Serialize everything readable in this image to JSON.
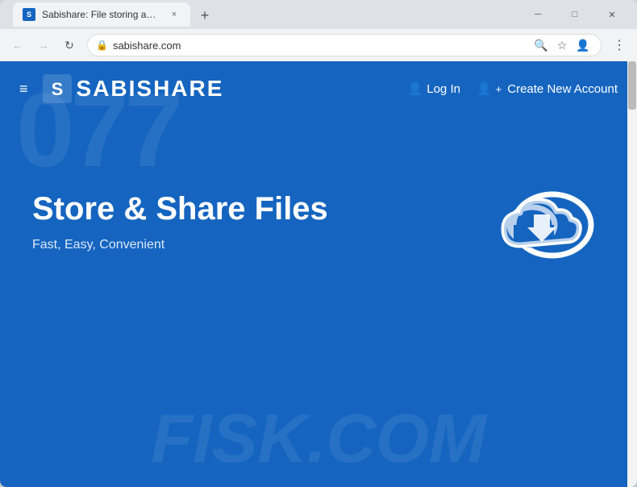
{
  "browser": {
    "tab": {
      "favicon": "S",
      "title": "Sabishare: File storing and sharin...",
      "close_label": "×"
    },
    "new_tab_label": "+",
    "window_controls": {
      "minimize": "─",
      "maximize": "□",
      "close": "✕"
    },
    "address_bar": {
      "url": "sabishare.com",
      "lock_icon": "🔒",
      "search_icon": "🔍",
      "star_icon": "☆",
      "profile_icon": "👤",
      "menu_icon": "⋮",
      "back_icon": "←",
      "forward_icon": "→",
      "refresh_icon": "↻"
    }
  },
  "site": {
    "logo_initial": "S",
    "logo_text": "SABISHARE",
    "hamburger": "≡",
    "nav": {
      "login_icon": "👤",
      "login_label": "Log In",
      "register_icon": "👤+",
      "register_label": "Create New Account"
    },
    "hero": {
      "title": "Store & Share Files",
      "subtitle": "Fast, Easy, Convenient"
    },
    "watermark_top": "077",
    "watermark_bottom": "FISK.COM",
    "colors": {
      "bg": "#1565c0",
      "bg_dark": "#0d47a1",
      "text_white": "#ffffff"
    }
  }
}
